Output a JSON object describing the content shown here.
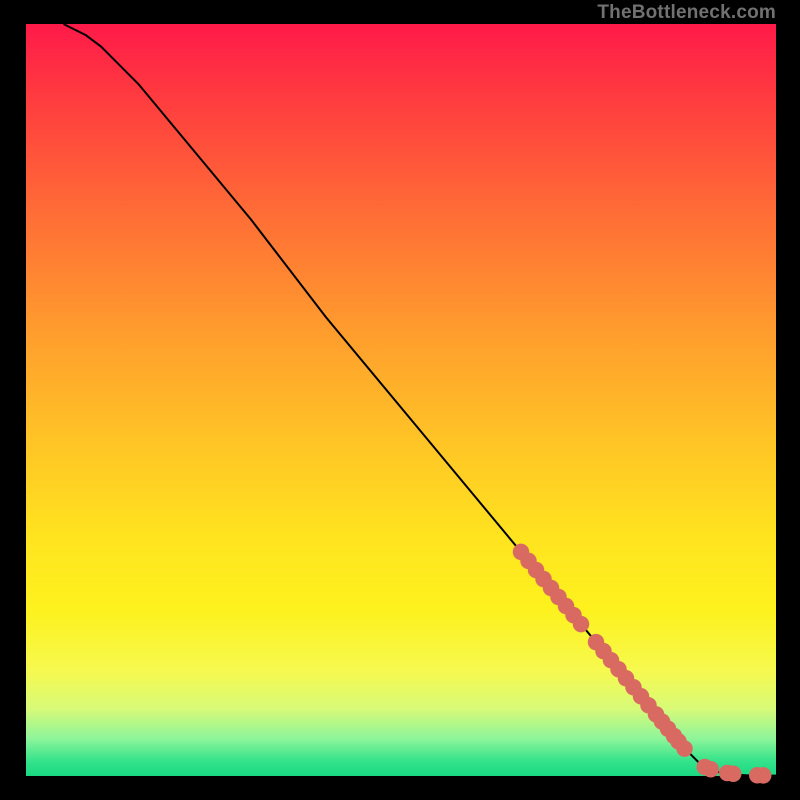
{
  "attribution": "TheBottleneck.com",
  "chart_data": {
    "type": "line",
    "title": "",
    "xlabel": "",
    "ylabel": "",
    "xlim": [
      0,
      100
    ],
    "ylim": [
      0,
      100
    ],
    "grid": false,
    "legend": false,
    "curve": {
      "name": "bottleneck-curve",
      "color": "#000000",
      "x": [
        5,
        6,
        8,
        10,
        12,
        15,
        20,
        30,
        40,
        50,
        60,
        70,
        80,
        85,
        88,
        90,
        92,
        94,
        96,
        98,
        100
      ],
      "y": [
        100,
        99.5,
        98.5,
        97,
        95,
        92,
        86,
        74,
        61,
        49,
        37,
        25,
        13,
        7,
        3.5,
        1.5,
        0.6,
        0.2,
        0.1,
        0.05,
        0.05
      ]
    },
    "markers": {
      "name": "highlighted-points",
      "color": "#d86a62",
      "radius_pct": 1.1,
      "x": [
        66,
        67,
        68,
        69,
        70,
        71,
        72,
        73,
        74,
        76,
        77,
        78,
        79,
        80,
        81,
        82,
        83,
        84,
        84.8,
        85.6,
        86.4,
        87,
        87.8,
        90.5,
        91.3,
        93.5,
        94.3,
        97.5,
        98.3
      ],
      "y": [
        29.8,
        28.6,
        27.4,
        26.2,
        25.0,
        23.8,
        22.6,
        21.4,
        20.2,
        17.8,
        16.6,
        15.4,
        14.2,
        13.0,
        11.8,
        10.6,
        9.4,
        8.2,
        7.24,
        6.28,
        5.32,
        4.6,
        3.64,
        1.2,
        0.9,
        0.4,
        0.3,
        0.1,
        0.08
      ]
    }
  }
}
